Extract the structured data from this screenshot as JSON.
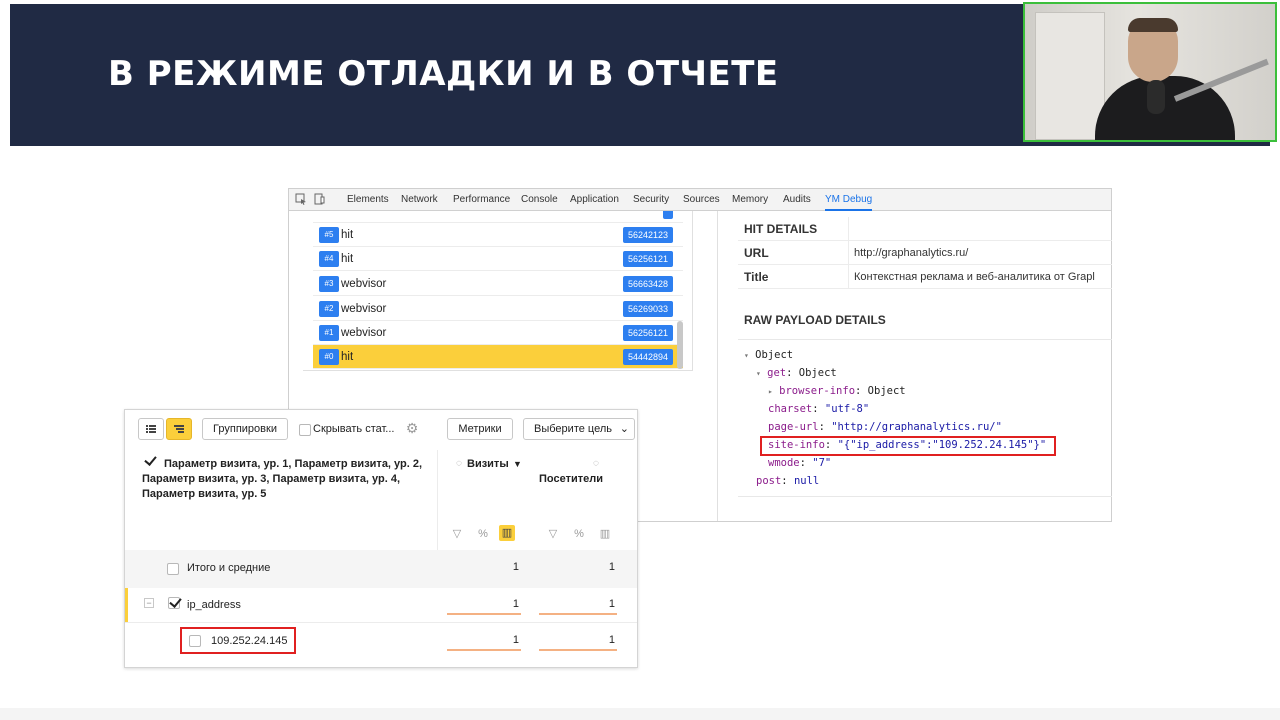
{
  "slide": {
    "title": "В РЕЖИМЕ ОТЛАДКИ И В ОТЧЕТЕ"
  },
  "devtools": {
    "tabs": [
      {
        "label": "Elements"
      },
      {
        "label": "Network"
      },
      {
        "label": "Performance"
      },
      {
        "label": "Console"
      },
      {
        "label": "Application"
      },
      {
        "label": "Security"
      },
      {
        "label": "Sources"
      },
      {
        "label": "Memory"
      },
      {
        "label": "Audits"
      },
      {
        "label": "YM Debug"
      }
    ],
    "active_tab": "YM Debug",
    "hits": [
      {
        "num": "#5",
        "type": "hit",
        "id": "56242123"
      },
      {
        "num": "#4",
        "type": "hit",
        "id": "56256121"
      },
      {
        "num": "#3",
        "type": "webvisor",
        "id": "56663428"
      },
      {
        "num": "#2",
        "type": "webvisor",
        "id": "56269033"
      },
      {
        "num": "#1",
        "type": "webvisor",
        "id": "56256121"
      },
      {
        "num": "#0",
        "type": "hit",
        "id": "54442894"
      }
    ],
    "details": {
      "hit_details_title": "HIT DETAILS",
      "rows": [
        {
          "key": "URL",
          "value": "http://graphanalytics.ru/"
        },
        {
          "key": "Title",
          "value": "Контекстная реклама и веб-аналитика от Grapl"
        }
      ],
      "raw_payload_title": "RAW PAYLOAD DETAILS",
      "payload": {
        "object_label": "Object",
        "get_key": "get",
        "get_val": "Object",
        "browser_info_key": "browser-info",
        "browser_info_val": "Object",
        "charset_key": "charset",
        "charset_val": "\"utf-8\"",
        "page_url_key": "page-url",
        "page_url_val": "\"http://graphanalytics.ru/\"",
        "site_info_key": "site-info",
        "site_info_val": "\"{\"ip_address\":\"109.252.24.145\"}\"",
        "wmode_key": "wmode",
        "wmode_val": "\"7\"",
        "post_key": "post",
        "post_val": "null"
      }
    }
  },
  "report": {
    "groupings_button": "Группировки",
    "hide_stats_label": "Скрывать стат...",
    "metrics_button": "Метрики",
    "goal_select": "Выберите цель",
    "dimension_header": "Параметр визита, ур. 1, Параметр визита, ур. 2, Параметр визита, ур. 3, Параметр визита, ур. 4, Параметр визита, ур. 5",
    "col_visits": "Визиты",
    "col_visitors": "Посетители",
    "sort_indicator": "▼",
    "rows": [
      {
        "label": "Итого и средние",
        "visits": "1",
        "visitors": "1"
      },
      {
        "label": "ip_address",
        "visits": "1",
        "visitors": "1"
      },
      {
        "label": "109.252.24.145",
        "visits": "1",
        "visitors": "1"
      }
    ]
  }
}
